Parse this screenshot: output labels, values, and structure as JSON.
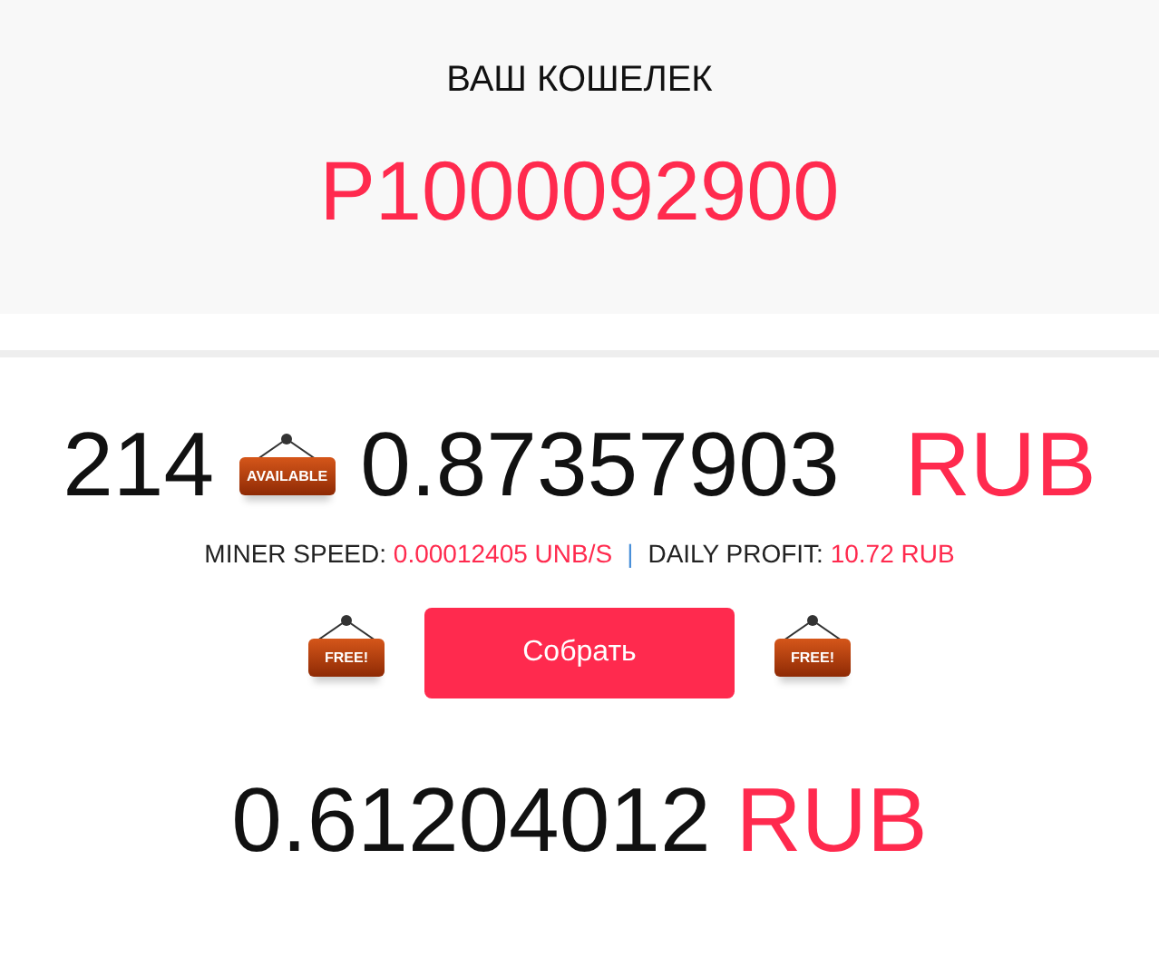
{
  "wallet": {
    "title": "ВАШ КОШЕЛЕК",
    "id": "P1000092900"
  },
  "balance": {
    "count": "214",
    "sign": "AVAILABLE",
    "amount": "0.87357903",
    "currency": "RUB"
  },
  "stats": [
    {
      "label": "MINER SPEED:",
      "value": "0.00012405 UNB/S"
    },
    {
      "label": "DAILY PROFIT:",
      "value": "10.72 RUB"
    }
  ],
  "separator": "|",
  "collect": {
    "left_sign": "FREE!",
    "button": "Собрать",
    "right_sign": "FREE!"
  },
  "total": {
    "amount": "0.61204012",
    "currency": "RUB"
  }
}
